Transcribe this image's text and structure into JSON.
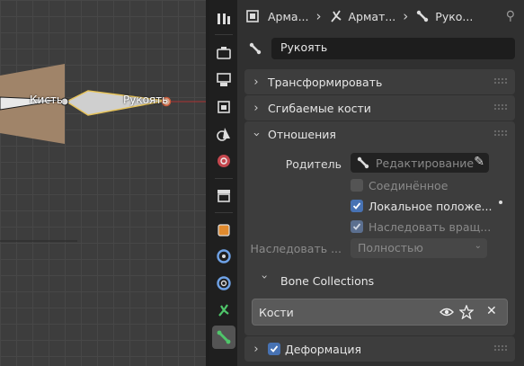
{
  "viewport": {
    "bone_label_1": "Кисть",
    "bone_label_2": "Рукоять"
  },
  "header": {
    "crumb1": "Арма...",
    "crumb2": "Армат...",
    "crumb3": "Руко..."
  },
  "bone_name": "Рукоять",
  "sections": {
    "transform": "Трансформировать",
    "bendy_bones": "Сгибаемые кости",
    "relations": "Отношения",
    "deform": "Деформация"
  },
  "relations": {
    "parent_label": "Родитель",
    "parent_value": "Редактирование",
    "connected_label": "Соединённое",
    "local_location_label": "Локальное положе...",
    "inherit_rotation_label": "Наследовать вращ...",
    "inherit_label": "Наследовать ...",
    "inherit_value": "Полностью",
    "bone_collections_label": "Bone Collections",
    "collection_name": "Кости"
  },
  "states": {
    "connected": false,
    "local_location": true,
    "inherit_rotation": true,
    "deform": true
  },
  "colors": {
    "accent": "#4772b3",
    "selected_bone_outline": "#e6c35a"
  },
  "icons": {
    "tabs": [
      "tool-icon",
      "render-icon",
      "output-icon",
      "view-layer-icon",
      "scene-icon",
      "world-icon",
      "collection-icon",
      "object-icon",
      "modifiers-icon",
      "particles-icon",
      "physics-icon",
      "data-icon",
      "bone-icon"
    ]
  }
}
